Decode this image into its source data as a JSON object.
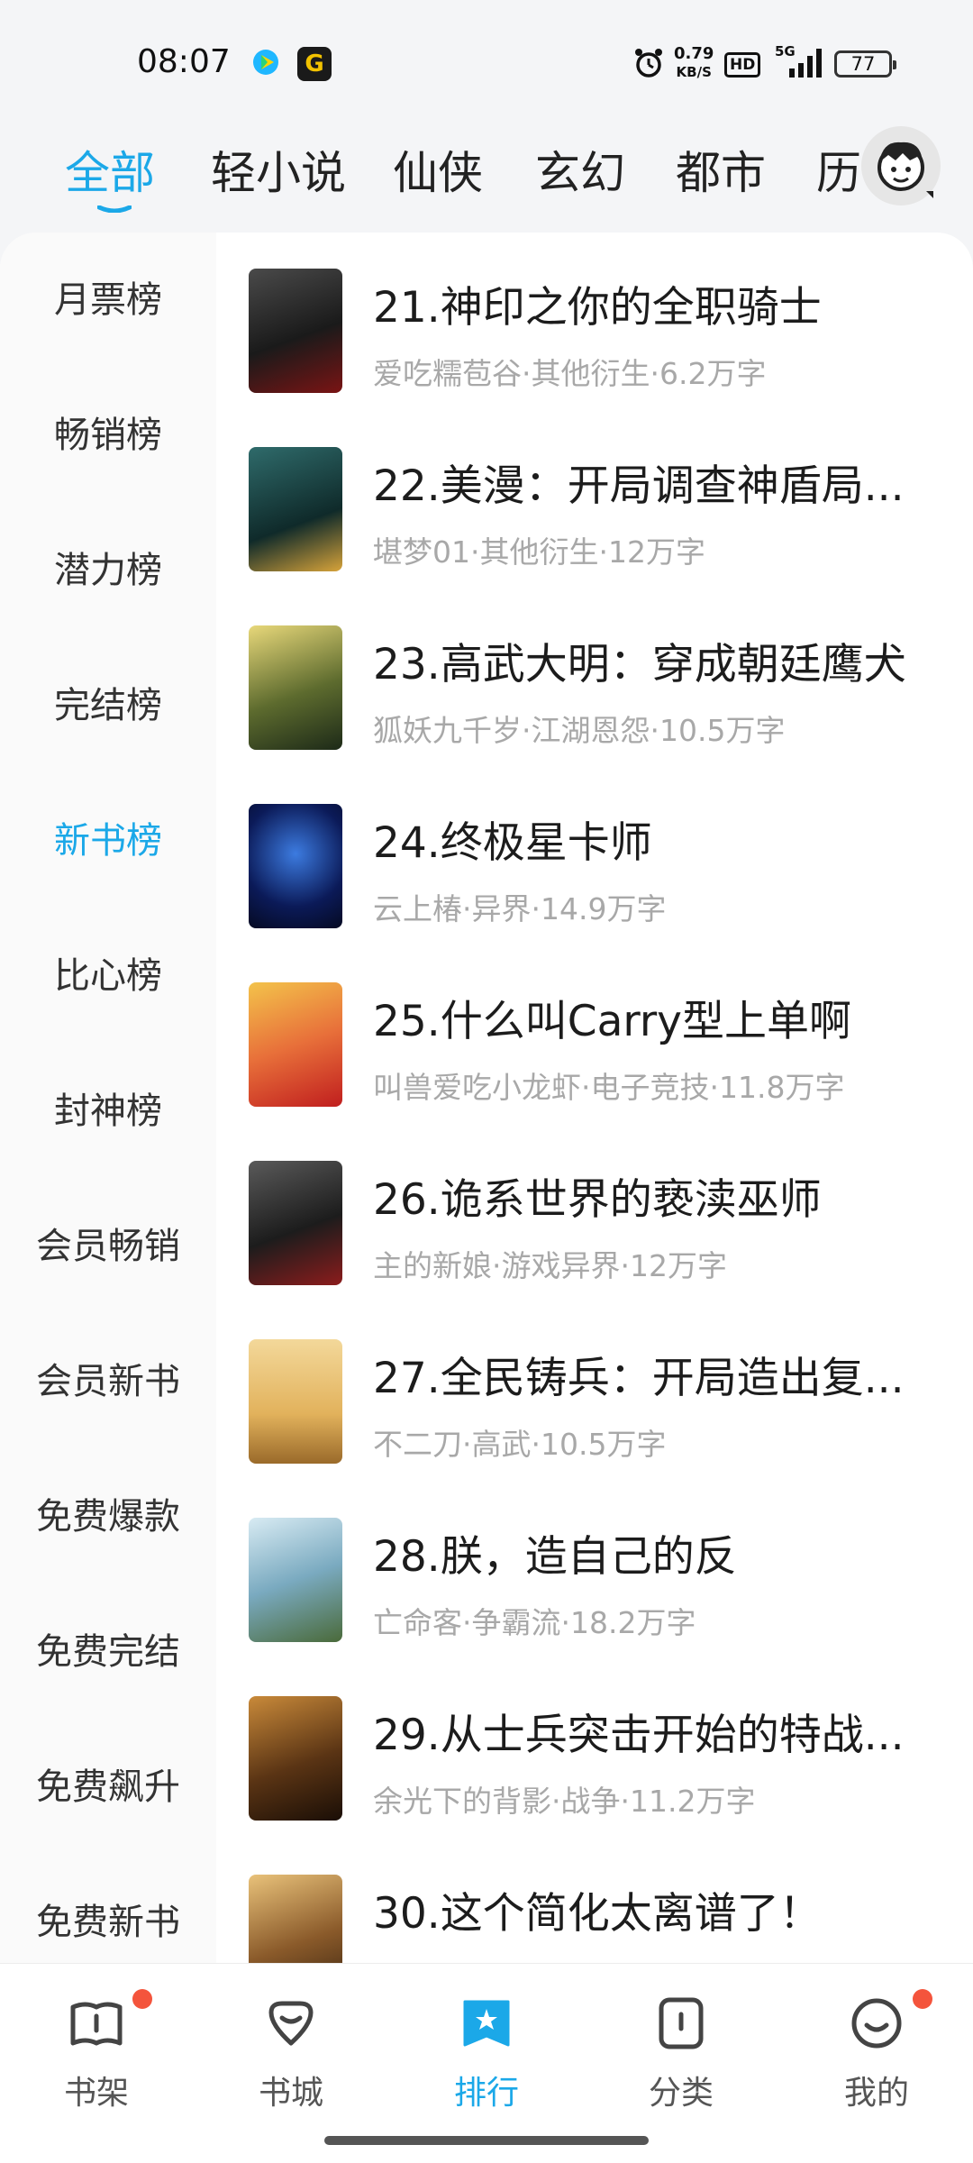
{
  "status_bar": {
    "time": "08:07",
    "net_speed_value": "0.79",
    "net_speed_unit": "KB/S",
    "hd_label": "HD",
    "network_type": "5G",
    "battery": "77"
  },
  "top_tabs": [
    {
      "label": "全部",
      "active": true
    },
    {
      "label": "轻小说",
      "active": false
    },
    {
      "label": "仙侠",
      "active": false
    },
    {
      "label": "玄幻",
      "active": false
    },
    {
      "label": "都市",
      "active": false
    },
    {
      "label": "历史",
      "active": false
    }
  ],
  "sidebar": {
    "items": [
      {
        "label": "月票榜"
      },
      {
        "label": "畅销榜"
      },
      {
        "label": "潜力榜"
      },
      {
        "label": "完结榜"
      },
      {
        "label": "新书榜",
        "active": true
      },
      {
        "label": "比心榜"
      },
      {
        "label": "封神榜"
      },
      {
        "label": "会员畅销"
      },
      {
        "label": "会员新书"
      },
      {
        "label": "免费爆款"
      },
      {
        "label": "免费完结"
      },
      {
        "label": "免费飙升"
      },
      {
        "label": "免费新书"
      }
    ]
  },
  "books": [
    {
      "title": "21.神印之你的全职骑士",
      "meta": "爱吃糯苞谷·其他衍生·6.2万字"
    },
    {
      "title": "22.美漫：开局调查神盾局...",
      "meta": "堪梦01·其他衍生·12万字"
    },
    {
      "title": "23.高武大明：穿成朝廷鹰犬",
      "meta": "狐妖九千岁·江湖恩怨·10.5万字"
    },
    {
      "title": "24.终极星卡师",
      "meta": "云上椿·异界·14.9万字"
    },
    {
      "title": "25.什么叫Carry型上单啊",
      "meta": "叫兽爱吃小龙虾·电子竞技·11.8万字"
    },
    {
      "title": "26.诡系世界的亵渎巫师",
      "meta": "主的新娘·游戏异界·12万字"
    },
    {
      "title": "27.全民铸兵：开局造出复...",
      "meta": "不二刀·高武·10.5万字"
    },
    {
      "title": "28.朕，造自己的反",
      "meta": "亡命客·争霸流·18.2万字"
    },
    {
      "title": "29.从士兵突击开始的特战...",
      "meta": "余光下的背影·战争·11.2万字"
    },
    {
      "title": "30.这个简化太离谱了！",
      "meta": ""
    }
  ],
  "bottom_nav": [
    {
      "label": "书架",
      "icon": "bookshelf-icon",
      "badge": true
    },
    {
      "label": "书城",
      "icon": "bookstore-icon",
      "badge": false
    },
    {
      "label": "排行",
      "icon": "ranking-icon",
      "badge": false,
      "active": true
    },
    {
      "label": "分类",
      "icon": "category-icon",
      "badge": false
    },
    {
      "label": "我的",
      "icon": "profile-icon",
      "badge": true
    }
  ],
  "colors": {
    "accent": "#1ba8e8",
    "badge": "#f4543c"
  }
}
